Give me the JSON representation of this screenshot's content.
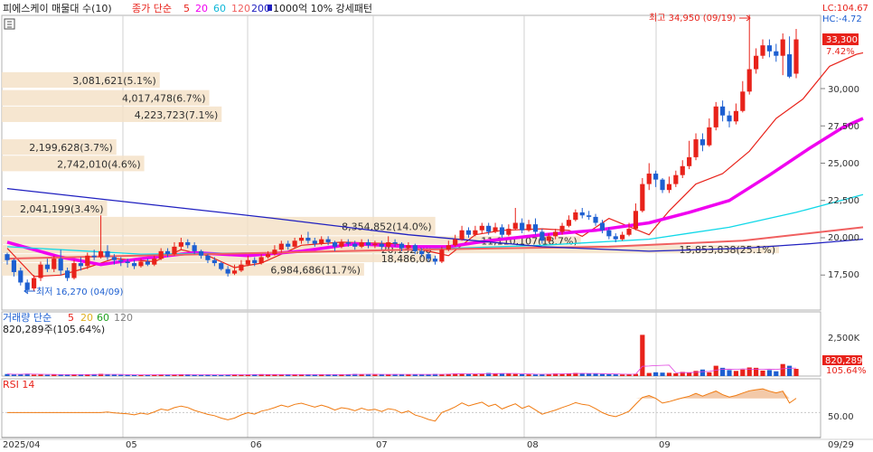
{
  "header": {
    "title": "피에스케이 매물대 수(10)",
    "ma_label": "종가 단순",
    "ma_periods": [
      "5",
      "20",
      "60",
      "120",
      "200"
    ],
    "pattern_label": "1000억 10% 강세패턴",
    "lc": "LC:104.67",
    "hc": "HC:-4.72"
  },
  "colors": {
    "up": "#e8221a",
    "down": "#1d5fd1",
    "ma5": "#e8221a",
    "ma20": "#f000f0",
    "ma60": "#10d8e8",
    "ma120": "#f06060",
    "ma200": "#2020c0",
    "profile": "#f4e2c8",
    "rsi": "#f07a10",
    "rsi_fill": "#f3c9a8"
  },
  "price_panel": {
    "last_price": "33,300",
    "last_change": "7.42%",
    "y_ticks": [
      "30,000",
      "27,500",
      "25,000",
      "22,500",
      "20,000",
      "17,500"
    ],
    "high_annotation": "최고 34,950 (09/19)",
    "low_annotation": "최저 16,270 (04/09)"
  },
  "volume_panel": {
    "ma_label": "거래량 단순",
    "ma_periods": [
      "5",
      "20",
      "60",
      "120"
    ],
    "current": "820,289주(105.64%)",
    "y_tick": "2,500K",
    "last_value": "820,289",
    "last_pct": "105.64%"
  },
  "rsi_panel": {
    "label": "RSI 14",
    "y_tick": "50.00"
  },
  "x_axis": {
    "labels": [
      "2025/04",
      "05",
      "06",
      "07",
      "08",
      "09",
      "09/29"
    ]
  },
  "chart_data": {
    "type": "candlestick",
    "title": "피에스케이 매물대 수(10)",
    "ylim": [
      16000,
      35500
    ],
    "y_ticks": [
      17500,
      20000,
      22500,
      25000,
      27500,
      30000
    ],
    "volume_profile": [
      {
        "label": "2,041,199(3.4%)",
        "low": 21400,
        "high": 22500
      },
      {
        "label": "8,354,852(14.0%)",
        "low": 20100,
        "high": 21400
      },
      {
        "label": "11,110,107(18.7%)",
        "low": 19500,
        "high": 20100
      },
      {
        "label": "15,853,838(25.1%)",
        "low": 18900,
        "high": 19500
      },
      {
        "label": "20,132,88",
        "low": 18900,
        "high": 19500
      },
      {
        "label": "18,486,00",
        "low": 18300,
        "high": 18900
      },
      {
        "label": "6,984,686(11.7%)",
        "low": 17400,
        "high": 18300
      },
      {
        "label": "2,742,010(4.6%)",
        "low": 24400,
        "high": 25500
      },
      {
        "label": "2,199,628(3.7%)",
        "low": 25500,
        "high": 26600
      },
      {
        "label": "4,223,723(7.1%)",
        "low": 27700,
        "high": 28800
      },
      {
        "label": "4,017,478(6.7%)",
        "low": 28800,
        "high": 29900
      },
      {
        "label": "3,081,621(5.1%)",
        "low": 30000,
        "high": 31100
      }
    ],
    "candles": [
      [
        18900,
        18500,
        19000,
        18200
      ],
      [
        18500,
        17700,
        18600,
        17400
      ],
      [
        17800,
        17000,
        18000,
        16800
      ],
      [
        17000,
        16500,
        17200,
        16270
      ],
      [
        16600,
        17300,
        17500,
        16400
      ],
      [
        17300,
        18200,
        18400,
        17100
      ],
      [
        18200,
        17900,
        18600,
        17700
      ],
      [
        17900,
        18600,
        18800,
        17700
      ],
      [
        18600,
        17800,
        19200,
        17500
      ],
      [
        17800,
        17300,
        18000,
        17100
      ],
      [
        17300,
        18300,
        18500,
        17200
      ],
      [
        18300,
        18100,
        18700,
        17800
      ],
      [
        18100,
        18800,
        19000,
        17900
      ],
      [
        18800,
        18700,
        19200,
        18500
      ],
      [
        18700,
        19100,
        21500,
        18600
      ],
      [
        19100,
        18700,
        19500,
        18500
      ],
      [
        18700,
        18500,
        18900,
        18200
      ],
      [
        18500,
        18400,
        18700,
        18100
      ],
      [
        18400,
        18300,
        18600,
        18000
      ],
      [
        18300,
        18100,
        18500,
        17900
      ],
      [
        18100,
        18400,
        18600,
        18000
      ],
      [
        18400,
        18200,
        18600,
        18100
      ],
      [
        18200,
        18600,
        18800,
        18100
      ],
      [
        18600,
        19100,
        19300,
        18500
      ],
      [
        19100,
        18900,
        19300,
        18700
      ],
      [
        18900,
        19400,
        19700,
        18800
      ],
      [
        19400,
        19700,
        20000,
        19200
      ],
      [
        19700,
        19500,
        19900,
        19300
      ],
      [
        19500,
        19100,
        19700,
        18900
      ],
      [
        19100,
        18800,
        19200,
        18600
      ],
      [
        18800,
        18500,
        18900,
        18300
      ],
      [
        18500,
        18300,
        18700,
        18100
      ],
      [
        18300,
        17900,
        18400,
        17800
      ],
      [
        17900,
        17600,
        18100,
        17400
      ],
      [
        17600,
        17800,
        18200,
        17500
      ],
      [
        17800,
        18200,
        18500,
        17700
      ],
      [
        18200,
        18500,
        18800,
        18100
      ],
      [
        18500,
        18300,
        18700,
        18100
      ],
      [
        18300,
        18700,
        18900,
        18200
      ],
      [
        18700,
        18900,
        19100,
        18600
      ],
      [
        18900,
        19200,
        19500,
        18800
      ],
      [
        19200,
        19600,
        19800,
        19000
      ],
      [
        19600,
        19400,
        19800,
        19200
      ],
      [
        19400,
        19800,
        20000,
        19300
      ],
      [
        19800,
        20000,
        20200,
        19600
      ],
      [
        20000,
        19800,
        20400,
        19600
      ],
      [
        19800,
        19600,
        20000,
        19400
      ],
      [
        19600,
        19900,
        20100,
        19500
      ],
      [
        19900,
        19700,
        20100,
        19500
      ],
      [
        19700,
        19400,
        19800,
        19100
      ],
      [
        19400,
        19700,
        19900,
        19300
      ],
      [
        19700,
        19600,
        19900,
        19400
      ],
      [
        19600,
        19400,
        19800,
        19200
      ],
      [
        19400,
        19700,
        19900,
        19300
      ],
      [
        19700,
        19500,
        19900,
        19300
      ],
      [
        19500,
        19600,
        19800,
        19300
      ],
      [
        19600,
        19400,
        19800,
        19200
      ],
      [
        19400,
        19700,
        20100,
        19300
      ],
      [
        19700,
        19600,
        19900,
        19400
      ],
      [
        19600,
        19300,
        19700,
        19100
      ],
      [
        19300,
        19500,
        19700,
        19200
      ],
      [
        19500,
        19100,
        19600,
        18900
      ],
      [
        19100,
        18900,
        19300,
        18700
      ],
      [
        18900,
        18600,
        19000,
        18400
      ],
      [
        18600,
        18400,
        18800,
        18200
      ],
      [
        18400,
        19200,
        19400,
        18300
      ],
      [
        19200,
        19500,
        19800,
        19100
      ],
      [
        19500,
        19900,
        20200,
        19400
      ],
      [
        19900,
        20500,
        20800,
        19800
      ],
      [
        20500,
        20200,
        20700,
        20000
      ],
      [
        20200,
        20500,
        20800,
        20100
      ],
      [
        20500,
        20800,
        21000,
        20300
      ],
      [
        20800,
        20400,
        21000,
        20200
      ],
      [
        20400,
        20700,
        21000,
        20300
      ],
      [
        20700,
        20200,
        20900,
        20000
      ],
      [
        20200,
        20600,
        20900,
        20100
      ],
      [
        20600,
        21000,
        22000,
        20500
      ],
      [
        21000,
        20500,
        21300,
        20300
      ],
      [
        20500,
        20900,
        21200,
        20400
      ],
      [
        20900,
        20400,
        21300,
        20200
      ],
      [
        20400,
        19800,
        20600,
        19600
      ],
      [
        19800,
        20100,
        20300,
        19700
      ],
      [
        20100,
        20400,
        20600,
        19900
      ],
      [
        20400,
        20800,
        21000,
        20200
      ],
      [
        20800,
        21200,
        21500,
        20700
      ],
      [
        21200,
        21700,
        21900,
        21100
      ],
      [
        21700,
        21500,
        22000,
        21300
      ],
      [
        21500,
        21400,
        21800,
        21200
      ],
      [
        21400,
        21000,
        21600,
        20800
      ],
      [
        21000,
        20500,
        21200,
        20300
      ],
      [
        20500,
        20100,
        20700,
        19900
      ],
      [
        20100,
        19900,
        20300,
        19700
      ],
      [
        19900,
        20200,
        20400,
        19800
      ],
      [
        20200,
        20600,
        21000,
        20100
      ],
      [
        20600,
        21800,
        22300,
        20500
      ],
      [
        21800,
        23600,
        24000,
        21700
      ],
      [
        23600,
        24300,
        25000,
        23200
      ],
      [
        24300,
        23900,
        24500,
        23400
      ],
      [
        23900,
        23200,
        24000,
        23000
      ],
      [
        23200,
        23600,
        24100,
        23000
      ],
      [
        23600,
        24200,
        24500,
        23400
      ],
      [
        24200,
        24800,
        25200,
        24000
      ],
      [
        24800,
        25400,
        26500,
        24600
      ],
      [
        25400,
        26600,
        27000,
        25200
      ],
      [
        26600,
        26200,
        27000,
        25800
      ],
      [
        26200,
        27400,
        28000,
        26100
      ],
      [
        27400,
        28800,
        29100,
        27200
      ],
      [
        28800,
        28200,
        29200,
        27800
      ],
      [
        28200,
        27800,
        28500,
        27400
      ],
      [
        27800,
        28500,
        29000,
        27600
      ],
      [
        28500,
        29800,
        30500,
        28400
      ],
      [
        29800,
        31300,
        34950,
        29600
      ],
      [
        31300,
        32200,
        32700,
        31000
      ],
      [
        32200,
        32900,
        33300,
        32000
      ],
      [
        32900,
        32500,
        33300,
        32100
      ],
      [
        32500,
        32200,
        33000,
        31800
      ],
      [
        32200,
        33300,
        33700,
        30900
      ],
      [
        32300,
        30800,
        33500,
        30700
      ],
      [
        31000,
        33300,
        34000,
        30700
      ]
    ],
    "ma_series": [
      {
        "name": "5",
        "color": "#e8221a",
        "width": 1.2,
        "values": [
          [
            0,
            19300
          ],
          [
            4,
            17400
          ],
          [
            8,
            17500
          ],
          [
            12,
            18000
          ],
          [
            16,
            18600
          ],
          [
            22,
            18400
          ],
          [
            26,
            19200
          ],
          [
            30,
            18800
          ],
          [
            34,
            18000
          ],
          [
            38,
            18300
          ],
          [
            44,
            19500
          ],
          [
            50,
            19700
          ],
          [
            58,
            19600
          ],
          [
            64,
            19000
          ],
          [
            66,
            18800
          ],
          [
            70,
            20200
          ],
          [
            74,
            20500
          ],
          [
            80,
            20600
          ],
          [
            84,
            20500
          ],
          [
            86,
            20100
          ],
          [
            90,
            21300
          ],
          [
            96,
            20200
          ],
          [
            99,
            21800
          ],
          [
            103,
            23600
          ],
          [
            107,
            24300
          ],
          [
            111,
            25800
          ],
          [
            115,
            28000
          ],
          [
            119,
            29300
          ],
          [
            123,
            31500
          ],
          [
            127,
            32300
          ],
          [
            128,
            32400
          ]
        ]
      },
      {
        "name": "20",
        "color": "#f000f0",
        "width": 3.5,
        "values": [
          [
            0,
            19700
          ],
          [
            8,
            18700
          ],
          [
            14,
            18200
          ],
          [
            20,
            18600
          ],
          [
            28,
            19000
          ],
          [
            36,
            18800
          ],
          [
            44,
            19100
          ],
          [
            52,
            19600
          ],
          [
            60,
            19400
          ],
          [
            66,
            19400
          ],
          [
            72,
            19800
          ],
          [
            80,
            20200
          ],
          [
            88,
            20500
          ],
          [
            96,
            21000
          ],
          [
            102,
            21700
          ],
          [
            108,
            22500
          ],
          [
            114,
            24200
          ],
          [
            120,
            26000
          ],
          [
            125,
            27400
          ],
          [
            128,
            28000
          ]
        ]
      },
      {
        "name": "60",
        "color": "#10d8e8",
        "width": 1.3,
        "values": [
          [
            0,
            19400
          ],
          [
            20,
            18900
          ],
          [
            40,
            19000
          ],
          [
            60,
            19200
          ],
          [
            80,
            19500
          ],
          [
            96,
            19900
          ],
          [
            108,
            20700
          ],
          [
            118,
            21700
          ],
          [
            128,
            22900
          ]
        ]
      },
      {
        "name": "120",
        "color": "#f06060",
        "width": 2,
        "values": [
          [
            0,
            18600
          ],
          [
            30,
            18900
          ],
          [
            60,
            19200
          ],
          [
            90,
            19400
          ],
          [
            110,
            19800
          ],
          [
            128,
            20700
          ]
        ]
      },
      {
        "name": "200",
        "color": "#2020c0",
        "width": 1.3,
        "values": [
          [
            0,
            23300
          ],
          [
            20,
            22300
          ],
          [
            40,
            21300
          ],
          [
            60,
            20200
          ],
          [
            80,
            19400
          ],
          [
            96,
            19100
          ],
          [
            110,
            19300
          ],
          [
            120,
            19600
          ],
          [
            128,
            19900
          ]
        ]
      }
    ],
    "volume": [
      120,
      90,
      110,
      140,
      80,
      95,
      70,
      85,
      100,
      75,
      90,
      80,
      95,
      110,
      130,
      85,
      75,
      70,
      65,
      80,
      75,
      70,
      85,
      90,
      75,
      80,
      95,
      85,
      70,
      65,
      75,
      80,
      70,
      85,
      90,
      75,
      80,
      95,
      110,
      85,
      80,
      75,
      90,
      100,
      85,
      80,
      75,
      90,
      85,
      80,
      95,
      100,
      120,
      110,
      95,
      90,
      85,
      100,
      110,
      105,
      95,
      90,
      85,
      100,
      120,
      110,
      130,
      150,
      140,
      120,
      110,
      130,
      180,
      160,
      150,
      140,
      120,
      110,
      100,
      95,
      110,
      130,
      150,
      140,
      160,
      180,
      150,
      140,
      130,
      120,
      110,
      100,
      95,
      110,
      130,
      2400,
      180,
      220,
      200,
      190,
      160,
      240,
      200,
      300,
      380,
      220,
      600,
      480,
      350,
      300,
      380,
      500,
      480,
      320,
      350,
      280,
      700,
      600,
      420,
      380,
      350,
      300,
      330,
      320,
      350,
      380,
      350,
      330,
      300
    ],
    "volume_max_axis": 3000
  }
}
